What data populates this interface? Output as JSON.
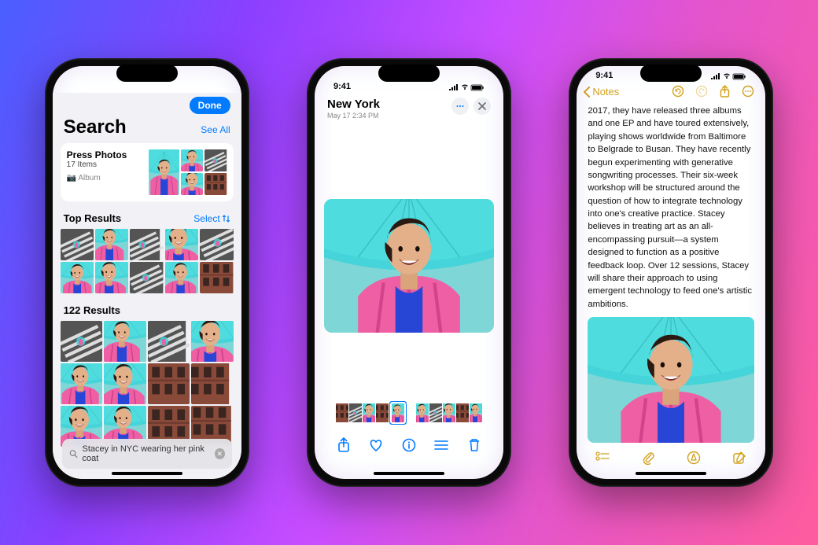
{
  "status_time": "9:41",
  "phone1": {
    "done": "Done",
    "title": "Search",
    "see_all": "See All",
    "album": {
      "name": "Press Photos",
      "items": "17 Items",
      "type": "📷 Album"
    },
    "top_results": "Top Results",
    "select": "Select",
    "results_count": "122 Results",
    "search_query": "Stacey in NYC wearing her pink coat"
  },
  "phone2": {
    "location": "New York",
    "timestamp": "May 17  2:34 PM"
  },
  "phone3": {
    "back": "Notes",
    "body": "2017, they have released three albums and one EP and have toured extensively, playing shows worldwide from Baltimore to Belgrade to Busan. They have recently begun experimenting with generative songwriting processes. Their six-week workshop will be structured around the question of how to integrate technology into one's creative practice. Stacey believes in treating art as an all-encompassing pursuit—a system designed to function as a positive feedback loop. Over 12 sessions, Stacey will share their approach to using emergent technology to feed one's artistic ambitions."
  }
}
